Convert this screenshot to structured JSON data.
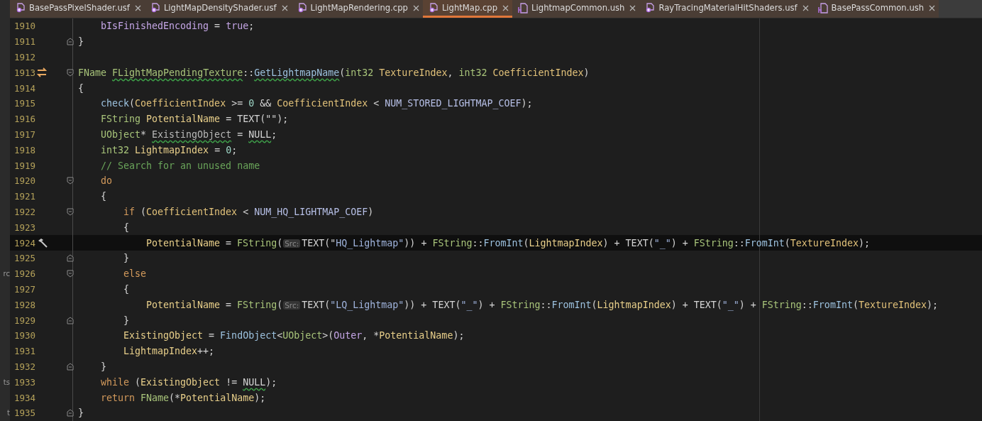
{
  "tabs": [
    {
      "label": "BasePassPixelShader.usf",
      "kind": "shader",
      "selected": false
    },
    {
      "label": "LightMapDensityShader.usf",
      "kind": "shader",
      "selected": false
    },
    {
      "label": "LightMapRendering.cpp",
      "kind": "shader",
      "selected": false
    },
    {
      "label": "LightMap.cpp",
      "kind": "shader",
      "selected": true
    },
    {
      "label": "LightmapCommon.ush",
      "kind": "header",
      "selected": false
    },
    {
      "label": "RayTracingMaterialHitShaders.usf",
      "kind": "shader",
      "selected": false
    },
    {
      "label": "BasePassCommon.ush",
      "kind": "header",
      "selected": false
    }
  ],
  "lines": [
    {
      "children": [
        {
          "number": "1910",
          "tokens": [
            {
              "kind": "field",
              "text": "bIsFinishedEncoding"
            },
            {
              "kind": "p",
              "text": " = "
            },
            {
              "kind": "const",
              "text": "true"
            },
            {
              "kind": "p",
              "text": ";"
            }
          ]
        }
      ]
    },
    {
      "number": "1911",
      "fold": {
        "kind": "close"
      },
      "tokens": [
        {
          "kind": "p",
          "text": "}"
        }
      ]
    },
    {
      "number": "1912"
    },
    {
      "number": "1913",
      "gutter": {
        "kind": "swap"
      },
      "fold": {
        "kind": "open"
      },
      "tokens": [
        {
          "kind": "type",
          "text": "FName "
        },
        {
          "kind": "type",
          "text": "FLightMapPendingTexture",
          "warn": true
        },
        {
          "kind": "p",
          "text": "::"
        },
        {
          "kind": "fn",
          "text": "GetLightmapName",
          "warn": true
        },
        {
          "kind": "p",
          "text": "("
        },
        {
          "kind": "type",
          "text": "int32 "
        },
        {
          "kind": "param",
          "text": "TextureIndex"
        },
        {
          "kind": "p",
          "text": ", "
        },
        {
          "kind": "type",
          "text": "int32 "
        },
        {
          "kind": "param",
          "text": "CoefficientIndex"
        },
        {
          "kind": "p",
          "text": ")"
        }
      ]
    },
    {
      "number": "1914",
      "tokens": [
        {
          "kind": "p",
          "text": "{"
        }
      ],
      "children": [
        {
          "number": "1915",
          "tokens": [
            {
              "kind": "fn",
              "text": "check"
            },
            {
              "kind": "p",
              "text": "("
            },
            {
              "kind": "param",
              "text": "CoefficientIndex"
            },
            {
              "kind": "p",
              "text": " >= "
            },
            {
              "kind": "num",
              "text": "0"
            },
            {
              "kind": "p",
              "text": " && "
            },
            {
              "kind": "param",
              "text": "CoefficientIndex"
            },
            {
              "kind": "p",
              "text": " < "
            },
            {
              "kind": "macro",
              "text": "NUM_STORED_LIGHTMAP_COEF"
            },
            {
              "kind": "p",
              "text": ");"
            }
          ]
        },
        {
          "number": "1916",
          "tokens": [
            {
              "kind": "type",
              "text": "FString "
            },
            {
              "kind": "local",
              "text": "PotentialName"
            },
            {
              "kind": "p",
              "text": " = TEXT(\"\");"
            }
          ]
        },
        {
          "number": "1917",
          "tokens": [
            {
              "kind": "type",
              "text": "UObject"
            },
            {
              "kind": "p",
              "text": "* "
            },
            {
              "kind": "unused",
              "text": "ExistingObject",
              "warn": true
            },
            {
              "kind": "p",
              "text": " = "
            },
            {
              "kind": "p",
              "text": "NULL",
              "warn": true
            },
            {
              "kind": "p",
              "text": ";"
            }
          ]
        },
        {
          "number": "1918",
          "tokens": [
            {
              "kind": "type",
              "text": "int32 "
            },
            {
              "kind": "local",
              "text": "LightmapIndex"
            },
            {
              "kind": "p",
              "text": " = "
            },
            {
              "kind": "num",
              "text": "0"
            },
            {
              "kind": "p",
              "text": ";"
            }
          ]
        },
        {
          "number": "1919",
          "tokens": [
            {
              "kind": "cmt",
              "text": "// Search for an unused name"
            }
          ]
        },
        {
          "number": "1920",
          "fold": {
            "kind": "open"
          },
          "tokens": [
            {
              "kind": "kw",
              "text": "do"
            }
          ]
        },
        {
          "number": "1921",
          "tokens": [
            {
              "kind": "p",
              "text": "{"
            }
          ],
          "children": [
            {
              "number": "1922",
              "fold": {
                "kind": "open"
              },
              "tokens": [
                {
                  "kind": "kw",
                  "text": "if"
                },
                {
                  "kind": "p",
                  "text": " ("
                },
                {
                  "kind": "param",
                  "text": "CoefficientIndex"
                },
                {
                  "kind": "p",
                  "text": " < "
                },
                {
                  "kind": "macro",
                  "text": "NUM_HQ_LIGHTMAP_COEF"
                },
                {
                  "kind": "p",
                  "text": ")"
                }
              ]
            },
            {
              "number": "1923",
              "tokens": [
                {
                  "kind": "p",
                  "text": "{"
                }
              ],
              "children": [
                {
                  "number": "1924",
                  "gutter": {
                    "kind": "hammer"
                  },
                  "selected": true,
                  "tokens": [
                    {
                      "kind": "local",
                      "text": "PotentialName"
                    },
                    {
                      "kind": "p",
                      "text": " = "
                    },
                    {
                      "kind": "type",
                      "text": "FString"
                    },
                    {
                      "kind": "p",
                      "text": "("
                    },
                    {
                      "kind": "hint",
                      "text": "Src:"
                    },
                    {
                      "kind": "p",
                      "text": "TEXT(\""
                    },
                    {
                      "kind": "str",
                      "text": "HQ_Lightmap\""
                    },
                    {
                      "kind": "p",
                      "text": ")) + "
                    },
                    {
                      "kind": "type",
                      "text": "FString"
                    },
                    {
                      "kind": "p",
                      "text": "::"
                    },
                    {
                      "kind": "fn",
                      "text": "FromInt"
                    },
                    {
                      "kind": "p",
                      "text": "("
                    },
                    {
                      "kind": "local",
                      "text": "LightmapIndex"
                    },
                    {
                      "kind": "p",
                      "text": ") + TEXT("
                    },
                    {
                      "kind": "str",
                      "text": "\"_\""
                    },
                    {
                      "kind": "p",
                      "text": ") + "
                    },
                    {
                      "kind": "type",
                      "text": "FString"
                    },
                    {
                      "kind": "p",
                      "text": "::"
                    },
                    {
                      "kind": "fn",
                      "text": "FromInt"
                    },
                    {
                      "kind": "p",
                      "text": "("
                    },
                    {
                      "kind": "param",
                      "text": "TextureIndex"
                    },
                    {
                      "kind": "p",
                      "text": ");"
                    }
                  ]
                }
              ]
            },
            {
              "number": "1925",
              "fold": {
                "kind": "close"
              },
              "tokens": [
                {
                  "kind": "p",
                  "text": "}"
                }
              ]
            },
            {
              "number": "1926",
              "fold": {
                "kind": "open"
              },
              "side": "rc",
              "tokens": [
                {
                  "kind": "kw",
                  "text": "else"
                }
              ]
            },
            {
              "number": "1927",
              "tokens": [
                {
                  "kind": "p",
                  "text": "{"
                }
              ],
              "children": [
                {
                  "number": "1928",
                  "tokens": [
                    {
                      "kind": "local",
                      "text": "PotentialName"
                    },
                    {
                      "kind": "p",
                      "text": " = "
                    },
                    {
                      "kind": "type",
                      "text": "FString"
                    },
                    {
                      "kind": "p",
                      "text": "("
                    },
                    {
                      "kind": "hint",
                      "text": "Src:"
                    },
                    {
                      "kind": "p",
                      "text": "TEXT("
                    },
                    {
                      "kind": "str",
                      "text": "\"LQ_Lightmap\""
                    },
                    {
                      "kind": "p",
                      "text": ")) + TEXT("
                    },
                    {
                      "kind": "str",
                      "text": "\"_\""
                    },
                    {
                      "kind": "p",
                      "text": ") + "
                    },
                    {
                      "kind": "type",
                      "text": "FString"
                    },
                    {
                      "kind": "p",
                      "text": "::"
                    },
                    {
                      "kind": "fn",
                      "text": "FromInt"
                    },
                    {
                      "kind": "p",
                      "text": "("
                    },
                    {
                      "kind": "local",
                      "text": "LightmapIndex"
                    },
                    {
                      "kind": "p",
                      "text": ") + TEXT("
                    },
                    {
                      "kind": "str",
                      "text": "\"_\""
                    },
                    {
                      "kind": "p",
                      "text": ") + "
                    },
                    {
                      "kind": "type",
                      "text": "FString"
                    },
                    {
                      "kind": "p",
                      "text": "::"
                    },
                    {
                      "kind": "fn",
                      "text": "FromInt"
                    },
                    {
                      "kind": "p",
                      "text": "("
                    },
                    {
                      "kind": "param",
                      "text": "TextureIndex"
                    },
                    {
                      "kind": "p",
                      "text": ");"
                    }
                  ]
                }
              ]
            },
            {
              "number": "1929",
              "fold": {
                "kind": "close"
              },
              "tokens": [
                {
                  "kind": "p",
                  "text": "}"
                }
              ]
            },
            {
              "number": "1930",
              "tokens": [
                {
                  "kind": "local",
                  "text": "ExistingObject"
                },
                {
                  "kind": "p",
                  "text": " = "
                },
                {
                  "kind": "fn",
                  "text": "FindObject"
                },
                {
                  "kind": "p",
                  "text": "<"
                },
                {
                  "kind": "type",
                  "text": "UObject"
                },
                {
                  "kind": "p",
                  "text": ">("
                },
                {
                  "kind": "field",
                  "text": "Outer"
                },
                {
                  "kind": "p",
                  "text": ", *"
                },
                {
                  "kind": "local",
                  "text": "PotentialName"
                },
                {
                  "kind": "p",
                  "text": ");"
                }
              ]
            },
            {
              "number": "1931",
              "tokens": [
                {
                  "kind": "local",
                  "text": "LightmapIndex"
                },
                {
                  "kind": "p",
                  "text": "++;"
                }
              ]
            }
          ]
        },
        {
          "number": "1932",
          "fold": {
            "kind": "close"
          },
          "tokens": [
            {
              "kind": "p",
              "text": "}"
            }
          ]
        },
        {
          "number": "1933",
          "side": "ts",
          "tokens": [
            {
              "kind": "kw",
              "text": "while"
            },
            {
              "kind": "p",
              "text": " ("
            },
            {
              "kind": "local",
              "text": "ExistingObject"
            },
            {
              "kind": "p",
              "text": " != "
            },
            {
              "kind": "p",
              "text": "NULL",
              "warn": true
            },
            {
              "kind": "p",
              "text": ");"
            }
          ]
        },
        {
          "number": "1934",
          "tokens": [
            {
              "kind": "kw",
              "text": "return "
            },
            {
              "kind": "type",
              "text": "FName"
            },
            {
              "kind": "p",
              "text": "(*"
            },
            {
              "kind": "local",
              "text": "PotentialName"
            },
            {
              "kind": "p",
              "text": ");"
            }
          ]
        }
      ]
    },
    {
      "number": "1935",
      "fold": {
        "kind": "close"
      },
      "side": "t",
      "tokens": [
        {
          "kind": "p",
          "text": "}"
        }
      ]
    }
  ]
}
